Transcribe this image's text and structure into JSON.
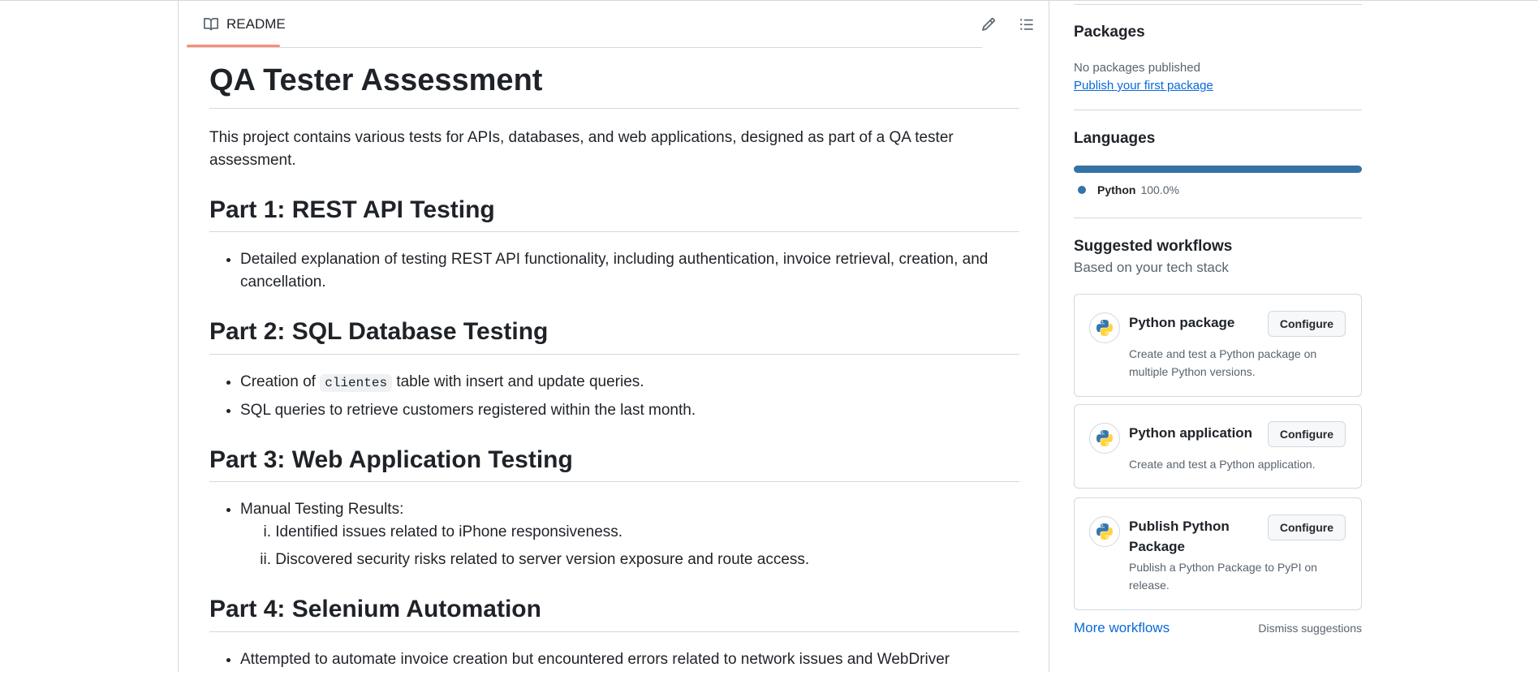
{
  "readme_tab": {
    "label": "README",
    "icon": "book-icon"
  },
  "header_actions": {
    "edit_icon": "pencil-icon",
    "toc_icon": "list-icon"
  },
  "content": {
    "title": "QA Tester Assessment",
    "intro": "This project contains various tests for APIs, databases, and web applications, designed as part of a QA tester assessment.",
    "part1": {
      "heading": "Part 1: REST API Testing",
      "item1": "Detailed explanation of testing REST API functionality, including authentication, invoice retrieval, creation, and cancellation."
    },
    "part2": {
      "heading": "Part 2: SQL Database Testing",
      "item1_prefix": "Creation of ",
      "item1_code": "clientes",
      "item1_suffix": " table with insert and update queries.",
      "item2": "SQL queries to retrieve customers registered within the last month."
    },
    "part3": {
      "heading": "Part 3: Web Application Testing",
      "item1": "Manual Testing Results:",
      "sub1_num": "i.",
      "sub1": "Identified issues related to iPhone responsiveness.",
      "sub2_num": "ii.",
      "sub2": "Discovered security risks related to server version exposure and route access."
    },
    "part4": {
      "heading": "Part 4: Selenium Automation",
      "item1": "Attempted to automate invoice creation but encountered errors related to network issues and WebDriver"
    }
  },
  "sidebar": {
    "packages": {
      "title": "Packages",
      "empty_text": "No packages published",
      "link": "Publish your first package"
    },
    "languages": {
      "title": "Languages",
      "items": [
        {
          "name": "Python",
          "percent": "100.0%",
          "fraction": 1.0,
          "color": "#3572a5"
        }
      ]
    },
    "workflows": {
      "title": "Suggested workflows",
      "subtitle": "Based on your tech stack",
      "cards": [
        {
          "name": "Python package",
          "description": "Create and test a Python package on multiple Python versions.",
          "button": "Configure",
          "icon": "python-icon"
        },
        {
          "name": "Python application",
          "description": "Create and test a Python application.",
          "button": "Configure",
          "icon": "python-icon"
        },
        {
          "name": "Publish Python Package",
          "description": "Publish a Python Package to PyPI on release.",
          "button": "Configure",
          "icon": "python-icon"
        }
      ],
      "more_link": "More workflows",
      "dismiss": "Dismiss suggestions"
    }
  }
}
